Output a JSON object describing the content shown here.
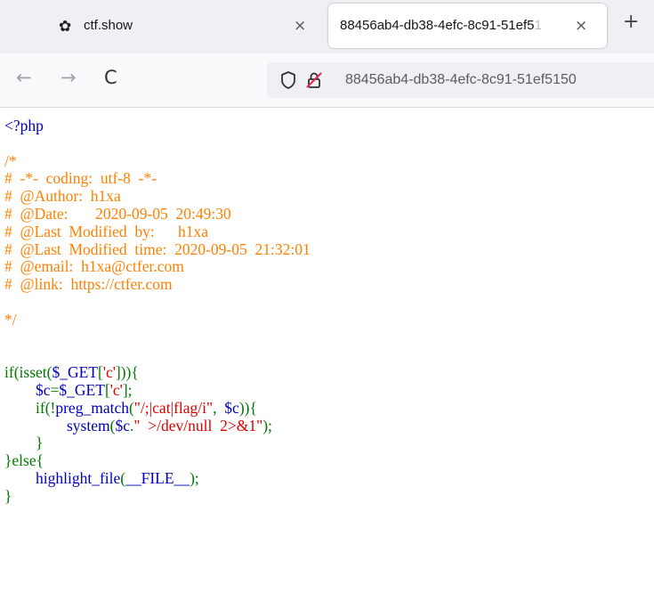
{
  "tabs": [
    {
      "title": "ctf.show",
      "close": "×",
      "active": false
    },
    {
      "title": "88456ab4-db38-4efc-8c91-51ef5",
      "title_fade": "1",
      "close": "×",
      "active": true
    }
  ],
  "new_tab": "+",
  "nav": {
    "back": "←",
    "forward": "→",
    "reload": "C"
  },
  "address": {
    "url": "88456ab4-db38-4efc-8c91-51ef5150"
  },
  "code": {
    "open_tag": "<?php",
    "comment": [
      "/*",
      "#  -*-  coding:  utf-8  -*-",
      "#  @Author:  h1xa",
      "#  @Date:       2020-09-05  20:49:30",
      "#  @Last  Modified  by:      h1xa",
      "#  @Last  Modified  time:  2020-09-05  21:32:01",
      "#  @email:  h1xa@ctfer.com",
      "#  @link:  https://ctfer.com",
      "",
      "*/"
    ],
    "l1_kw": "if(isset(",
    "l1_var": "$_GET",
    "l1_p1": "[",
    "l1_str": "'c'",
    "l1_p2": "])){",
    "l2_indent": "        ",
    "l2_var1": "$c",
    "l2_eq": "=",
    "l2_var2": "$_GET",
    "l2_p1": "[",
    "l2_str": "'c'",
    "l2_p2": "];",
    "l3_indent": "        ",
    "l3_kw": "if(!",
    "l3_fn": "preg_match",
    "l3_p1": "(",
    "l3_str": "\"/;|cat|flag/i\"",
    "l3_p2": ",  ",
    "l3_var": "$c",
    "l3_p3": ")){",
    "l4_indent": "                ",
    "l4_fn": "system",
    "l4_p1": "(",
    "l4_var": "$c",
    "l4_p2": ".",
    "l4_str": "\"  >/dev/null  2>&1\"",
    "l4_p3": ");",
    "l5_indent": "        ",
    "l5_brace": "}",
    "l6_else": "}else{",
    "l7_indent": "        ",
    "l7_fn": "highlight_file",
    "l7_p1": "(",
    "l7_const": "__FILE__",
    "l7_p2": ");",
    "l8_brace": "}"
  },
  "colors": {
    "html": "#000000",
    "default": "#0000bb",
    "comment": "#ff8000",
    "keyword": "#007700",
    "string": "#dd0000"
  }
}
